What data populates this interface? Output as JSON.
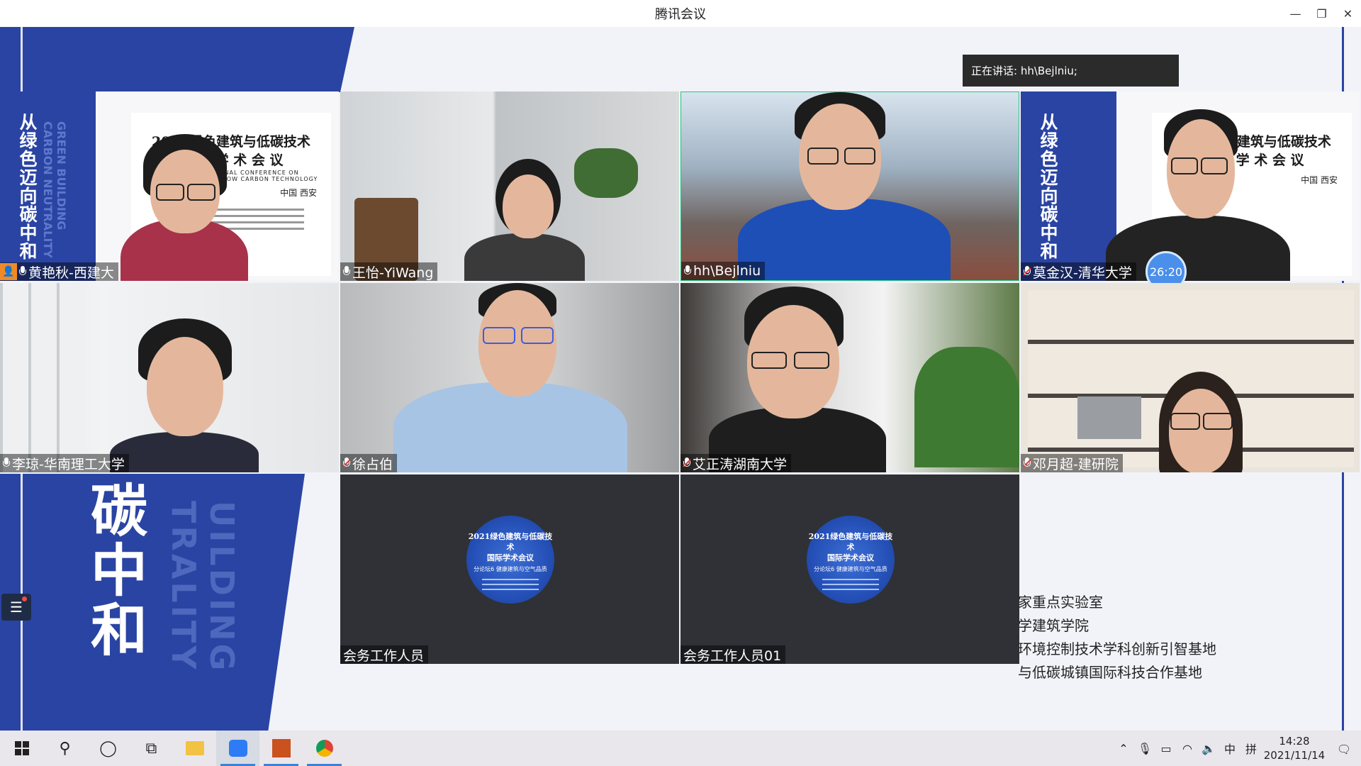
{
  "window": {
    "title": "腾讯会议",
    "minimize": "—",
    "restore": "❐",
    "close": "✕"
  },
  "banner": {
    "speaking": "正在讲话: hh\\Bejlniu;"
  },
  "slide": {
    "big_text": "碳中和",
    "en_text": "UILDING TRALITY",
    "lines": [
      "家重点实验室",
      "学建筑学院",
      "环境控制技术学科创新引智基地",
      "与低碳城镇国际科技合作基地"
    ]
  },
  "poster": {
    "title_line1": "2021绿色建筑与低碳技术",
    "title_line2": "国 际 学 术 会 议",
    "en_line1": "2021 INTERNATIONAL CONFERENCE ON",
    "en_line2": "GREEN BUILDING AND LOW CARBON TECHNOLOGY",
    "city": "中国 西安",
    "vertical": "从绿色迈向碳中和",
    "vertical_en": "GREEN BUILDING CARBON NEUTRALITY"
  },
  "disc": {
    "title_line1": "2021绿色建筑与低碳技术",
    "title_line2": "国际学术会议",
    "sub": "分论坛6 健康建筑与空气品质"
  },
  "participants": [
    {
      "name": "黄艳秋-西建大",
      "host": true
    },
    {
      "name": "王怡-YiWang"
    },
    {
      "name": "hh\\Bejlniu"
    },
    {
      "name": "莫金汉-清华大学",
      "timer": "26:20"
    },
    {
      "name": "李琼-华南理工大学"
    },
    {
      "name": "徐占伯"
    },
    {
      "name": "艾正涛湖南大学"
    },
    {
      "name": "邓月超-建研院"
    },
    {
      "name": "会务工作人员"
    },
    {
      "name": "会务工作人员01"
    }
  ],
  "taskbar": {
    "ime_lang": "中",
    "ime_mode": "拼",
    "time": "14:28",
    "date": "2021/11/14"
  }
}
